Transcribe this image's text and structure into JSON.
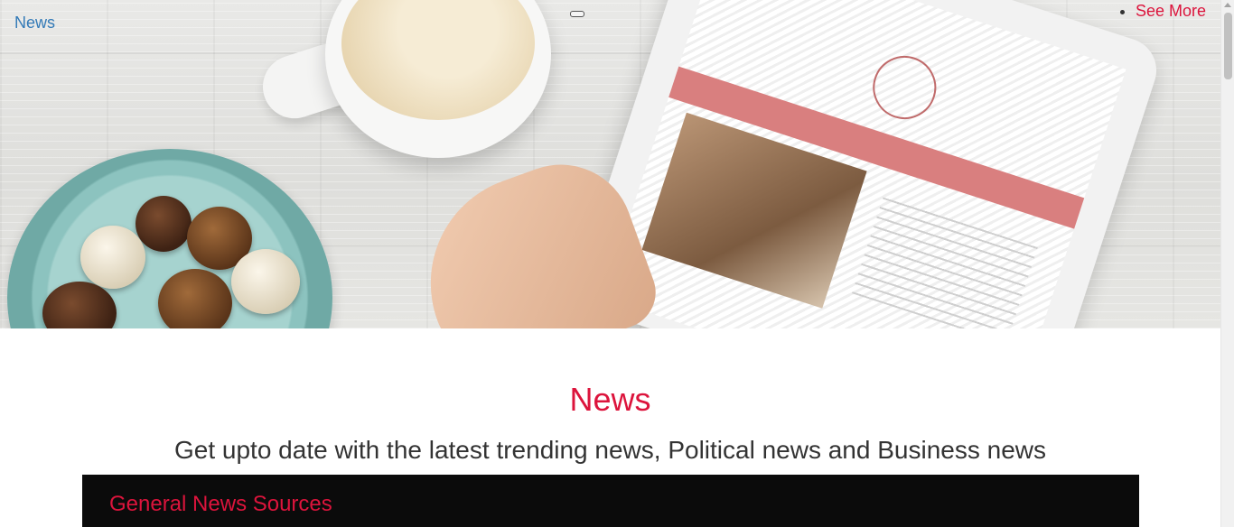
{
  "navbar": {
    "brand": "News",
    "links": [
      {
        "label": "See More"
      }
    ]
  },
  "hero": {
    "image_description_icon": "hero-photo"
  },
  "main": {
    "title": "News",
    "subtitle": "Get upto date with the latest trending news, Political news and Business news"
  },
  "sources_panel": {
    "title": "General News Sources"
  },
  "colors": {
    "accent": "#dc143c",
    "brand_link": "#337ab7",
    "panel_bg": "#0b0b0b",
    "text": "#333333"
  }
}
